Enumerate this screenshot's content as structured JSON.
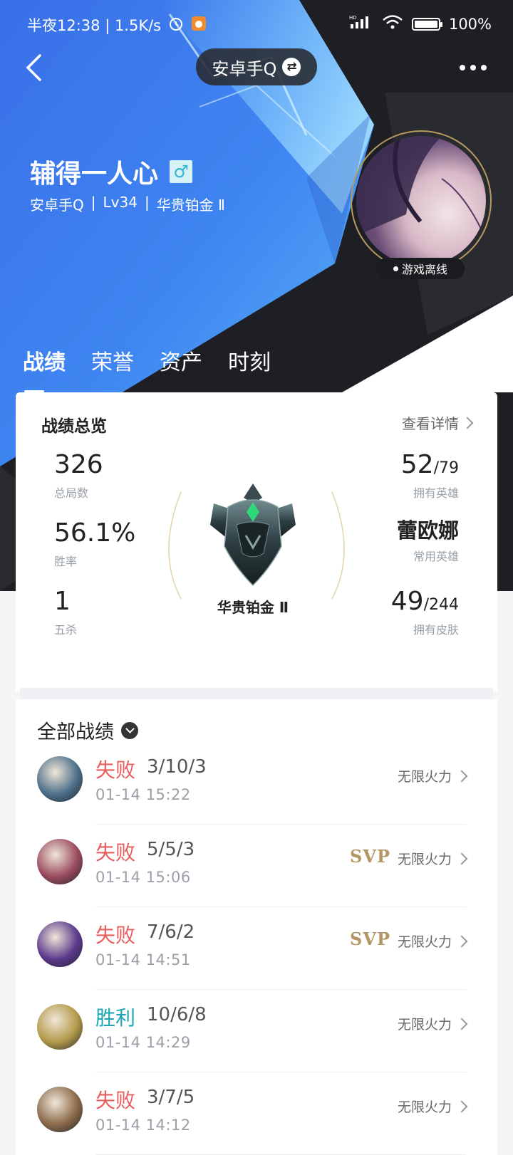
{
  "status_bar": {
    "time_text": "半夜12:38 | 1.5K/s",
    "battery_text": "100%",
    "battery_level": 1.0
  },
  "nav": {
    "account_label": "安卓手Q"
  },
  "profile": {
    "name": "辅得一人心",
    "server": "安卓手Q",
    "level": "Lv34",
    "rank": "华贵铂金 Ⅱ",
    "status": "游戏离线"
  },
  "tabs": [
    {
      "label": "战绩",
      "active": true
    },
    {
      "label": "荣誉",
      "active": false
    },
    {
      "label": "资产",
      "active": false
    },
    {
      "label": "时刻",
      "active": false
    }
  ],
  "overview": {
    "title": "战绩总览",
    "detail_link": "查看详情",
    "total_games": {
      "value": "326",
      "label": "总局数"
    },
    "win_rate": {
      "value": "56.1%",
      "label": "胜率"
    },
    "penta_kills": {
      "value": "1",
      "label": "五杀"
    },
    "heroes": {
      "value": "52",
      "total": "/79",
      "label": "拥有英雄"
    },
    "common_hero": {
      "value": "蕾欧娜",
      "label": "常用英雄"
    },
    "skins": {
      "value": "49",
      "total": "/244",
      "label": "拥有皮肤"
    },
    "rank_label": "华贵铂金 Ⅱ"
  },
  "records": {
    "title": "全部战绩",
    "matches": [
      {
        "result": "失败",
        "outcome": "lose",
        "kda": "3/10/3",
        "time": "01-14 15:22",
        "mode": "无限火力",
        "svp": "",
        "avatar_color": "#4d6f8a"
      },
      {
        "result": "失败",
        "outcome": "lose",
        "kda": "5/5/3",
        "time": "01-14 15:06",
        "mode": "无限火力",
        "svp": "SVP",
        "avatar_color": "#9a4a5e"
      },
      {
        "result": "失败",
        "outcome": "lose",
        "kda": "7/6/2",
        "time": "01-14 14:51",
        "mode": "无限火力",
        "svp": "SVP",
        "avatar_color": "#5b3a8c"
      },
      {
        "result": "胜利",
        "outcome": "win",
        "kda": "10/6/8",
        "time": "01-14 14:29",
        "mode": "无限火力",
        "svp": "",
        "avatar_color": "#b39a4a"
      },
      {
        "result": "失败",
        "outcome": "lose",
        "kda": "3/7/5",
        "time": "01-14 14:12",
        "mode": "无限火力",
        "svp": "",
        "avatar_color": "#8a6a4a"
      }
    ]
  },
  "colors": {
    "accent_blue": "#3f7df0",
    "lose": "#e85c5c",
    "win": "#1aa6b7",
    "svp_gold": "#b49663"
  }
}
